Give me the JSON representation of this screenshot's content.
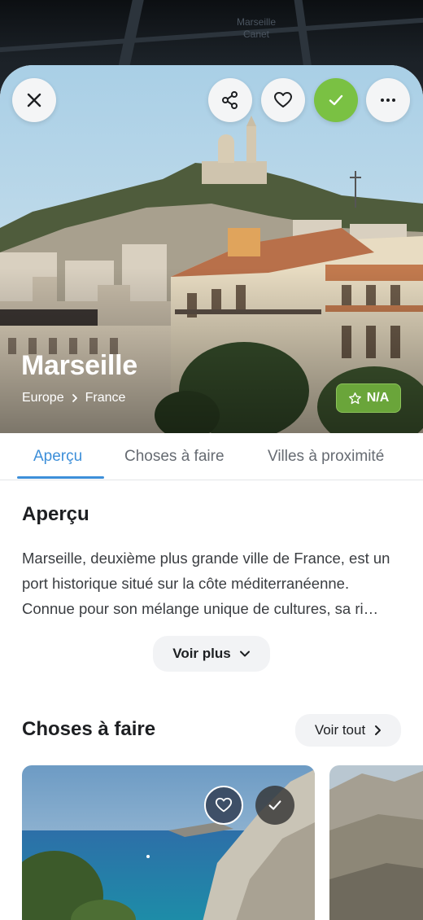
{
  "map": {
    "label": "Marseille Canet"
  },
  "hero": {
    "city": "Marseille",
    "breadcrumb": [
      "Europe",
      "France"
    ],
    "rating": "N/A"
  },
  "tabs": [
    "Aperçu",
    "Choses à faire",
    "Villes à proximité"
  ],
  "overview": {
    "title": "Aperçu",
    "text": "Marseille, deuxième plus grande ville de France, est un port historique situé sur la côte méditerranéenne. Connue pour son mélange unique de cultures, sa ri…",
    "more_label": "Voir plus"
  },
  "things_to_do": {
    "title": "Choses à faire",
    "see_all_label": "Voir tout"
  },
  "colors": {
    "accent_blue": "#3d8fd9",
    "check_green": "#7ac143",
    "rating_green": "#6aa53a"
  },
  "icons": [
    "close-icon",
    "share-icon",
    "heart-icon",
    "check-icon",
    "more-icon",
    "star-icon",
    "chevron-right-icon",
    "chevron-down-icon"
  ]
}
